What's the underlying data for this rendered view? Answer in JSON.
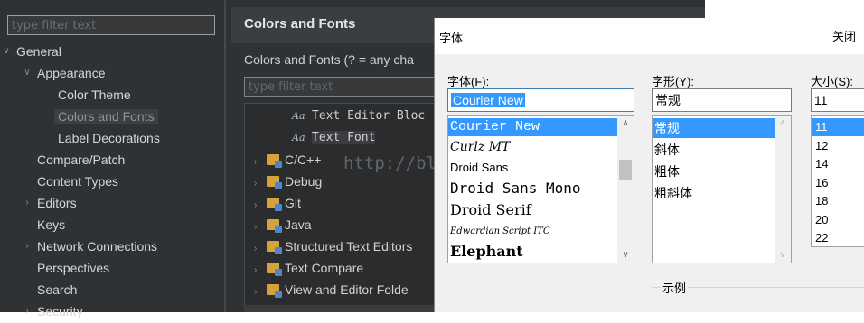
{
  "eclipse": {
    "filter_placeholder": "type filter text",
    "tree": [
      {
        "label": "General",
        "depth": 0,
        "twisty": "expanded"
      },
      {
        "label": "Appearance",
        "depth": 1,
        "twisty": "expanded"
      },
      {
        "label": "Color Theme",
        "depth": 2,
        "twisty": "none"
      },
      {
        "label": "Colors and Fonts",
        "depth": 2,
        "twisty": "none",
        "selected": true
      },
      {
        "label": "Label Decorations",
        "depth": 2,
        "twisty": "none"
      },
      {
        "label": "Compare/Patch",
        "depth": 1,
        "twisty": "none"
      },
      {
        "label": "Content Types",
        "depth": 1,
        "twisty": "none"
      },
      {
        "label": "Editors",
        "depth": 1,
        "twisty": "collapsed"
      },
      {
        "label": "Keys",
        "depth": 1,
        "twisty": "none"
      },
      {
        "label": "Network Connections",
        "depth": 1,
        "twisty": "collapsed"
      },
      {
        "label": "Perspectives",
        "depth": 1,
        "twisty": "none"
      },
      {
        "label": "Search",
        "depth": 1,
        "twisty": "none"
      },
      {
        "label": "Security",
        "depth": 1,
        "twisty": "collapsed"
      }
    ],
    "page_title": "Colors and Fonts",
    "description": "Colors and Fonts (? = any cha",
    "pref_filter_placeholder": "type filter text",
    "cf_tree": [
      {
        "label": "Text Editor Bloc",
        "kind": "font",
        "mono": true
      },
      {
        "label": "Text Font",
        "kind": "font",
        "mono": true,
        "highlight": true
      },
      {
        "label": "C/C++",
        "kind": "folder"
      },
      {
        "label": "Debug",
        "kind": "folder"
      },
      {
        "label": "Git",
        "kind": "folder"
      },
      {
        "label": "Java",
        "kind": "folder"
      },
      {
        "label": "Structured Text Editors",
        "kind": "folder"
      },
      {
        "label": "Text Compare",
        "kind": "folder"
      },
      {
        "label": "View and Editor Folde",
        "kind": "folder"
      }
    ],
    "font_icon_glyph": "Aa",
    "watermark": "http://blog.csdn.net/"
  },
  "dialog": {
    "title": "字体",
    "close_label": "关闭",
    "font_label": "字体(F):",
    "style_label": "字形(Y):",
    "size_label": "大小(S):",
    "font_value": "Courier New",
    "style_value": "常规",
    "size_value": "11",
    "fonts": [
      {
        "name": "Courier New",
        "family": "\"Liberation Mono\", monospace",
        "size": 15,
        "selected": true
      },
      {
        "name": "Curlz MT",
        "family": "\"DejaVu Serif\", serif",
        "size": 14,
        "italic": true
      },
      {
        "name": "Droid Sans",
        "family": "\"Liberation Sans\", sans-serif",
        "size": 13
      },
      {
        "name": "Droid Sans Mono",
        "family": "\"DejaVu Sans Mono\", monospace",
        "size": 16
      },
      {
        "name": "Droid Serif",
        "family": "\"DejaVu Serif\", serif",
        "size": 16
      },
      {
        "name": "Edwardian Script ITC",
        "family": "\"DejaVu Serif\", serif",
        "size": 10,
        "italic": true
      },
      {
        "name": "Elephant",
        "family": "\"DejaVu Serif\", serif",
        "size": 16,
        "bold": true
      }
    ],
    "styles": [
      {
        "name": "常规",
        "selected": true
      },
      {
        "name": "斜体"
      },
      {
        "name": "粗体"
      },
      {
        "name": "粗斜体"
      }
    ],
    "sizes": [
      {
        "name": "11",
        "selected": true
      },
      {
        "name": "12"
      },
      {
        "name": "14"
      },
      {
        "name": "16"
      },
      {
        "name": "18"
      },
      {
        "name": "20"
      },
      {
        "name": "22"
      }
    ],
    "sample_label": "示例",
    "scroll_up": "∧",
    "scroll_down": "∨"
  }
}
